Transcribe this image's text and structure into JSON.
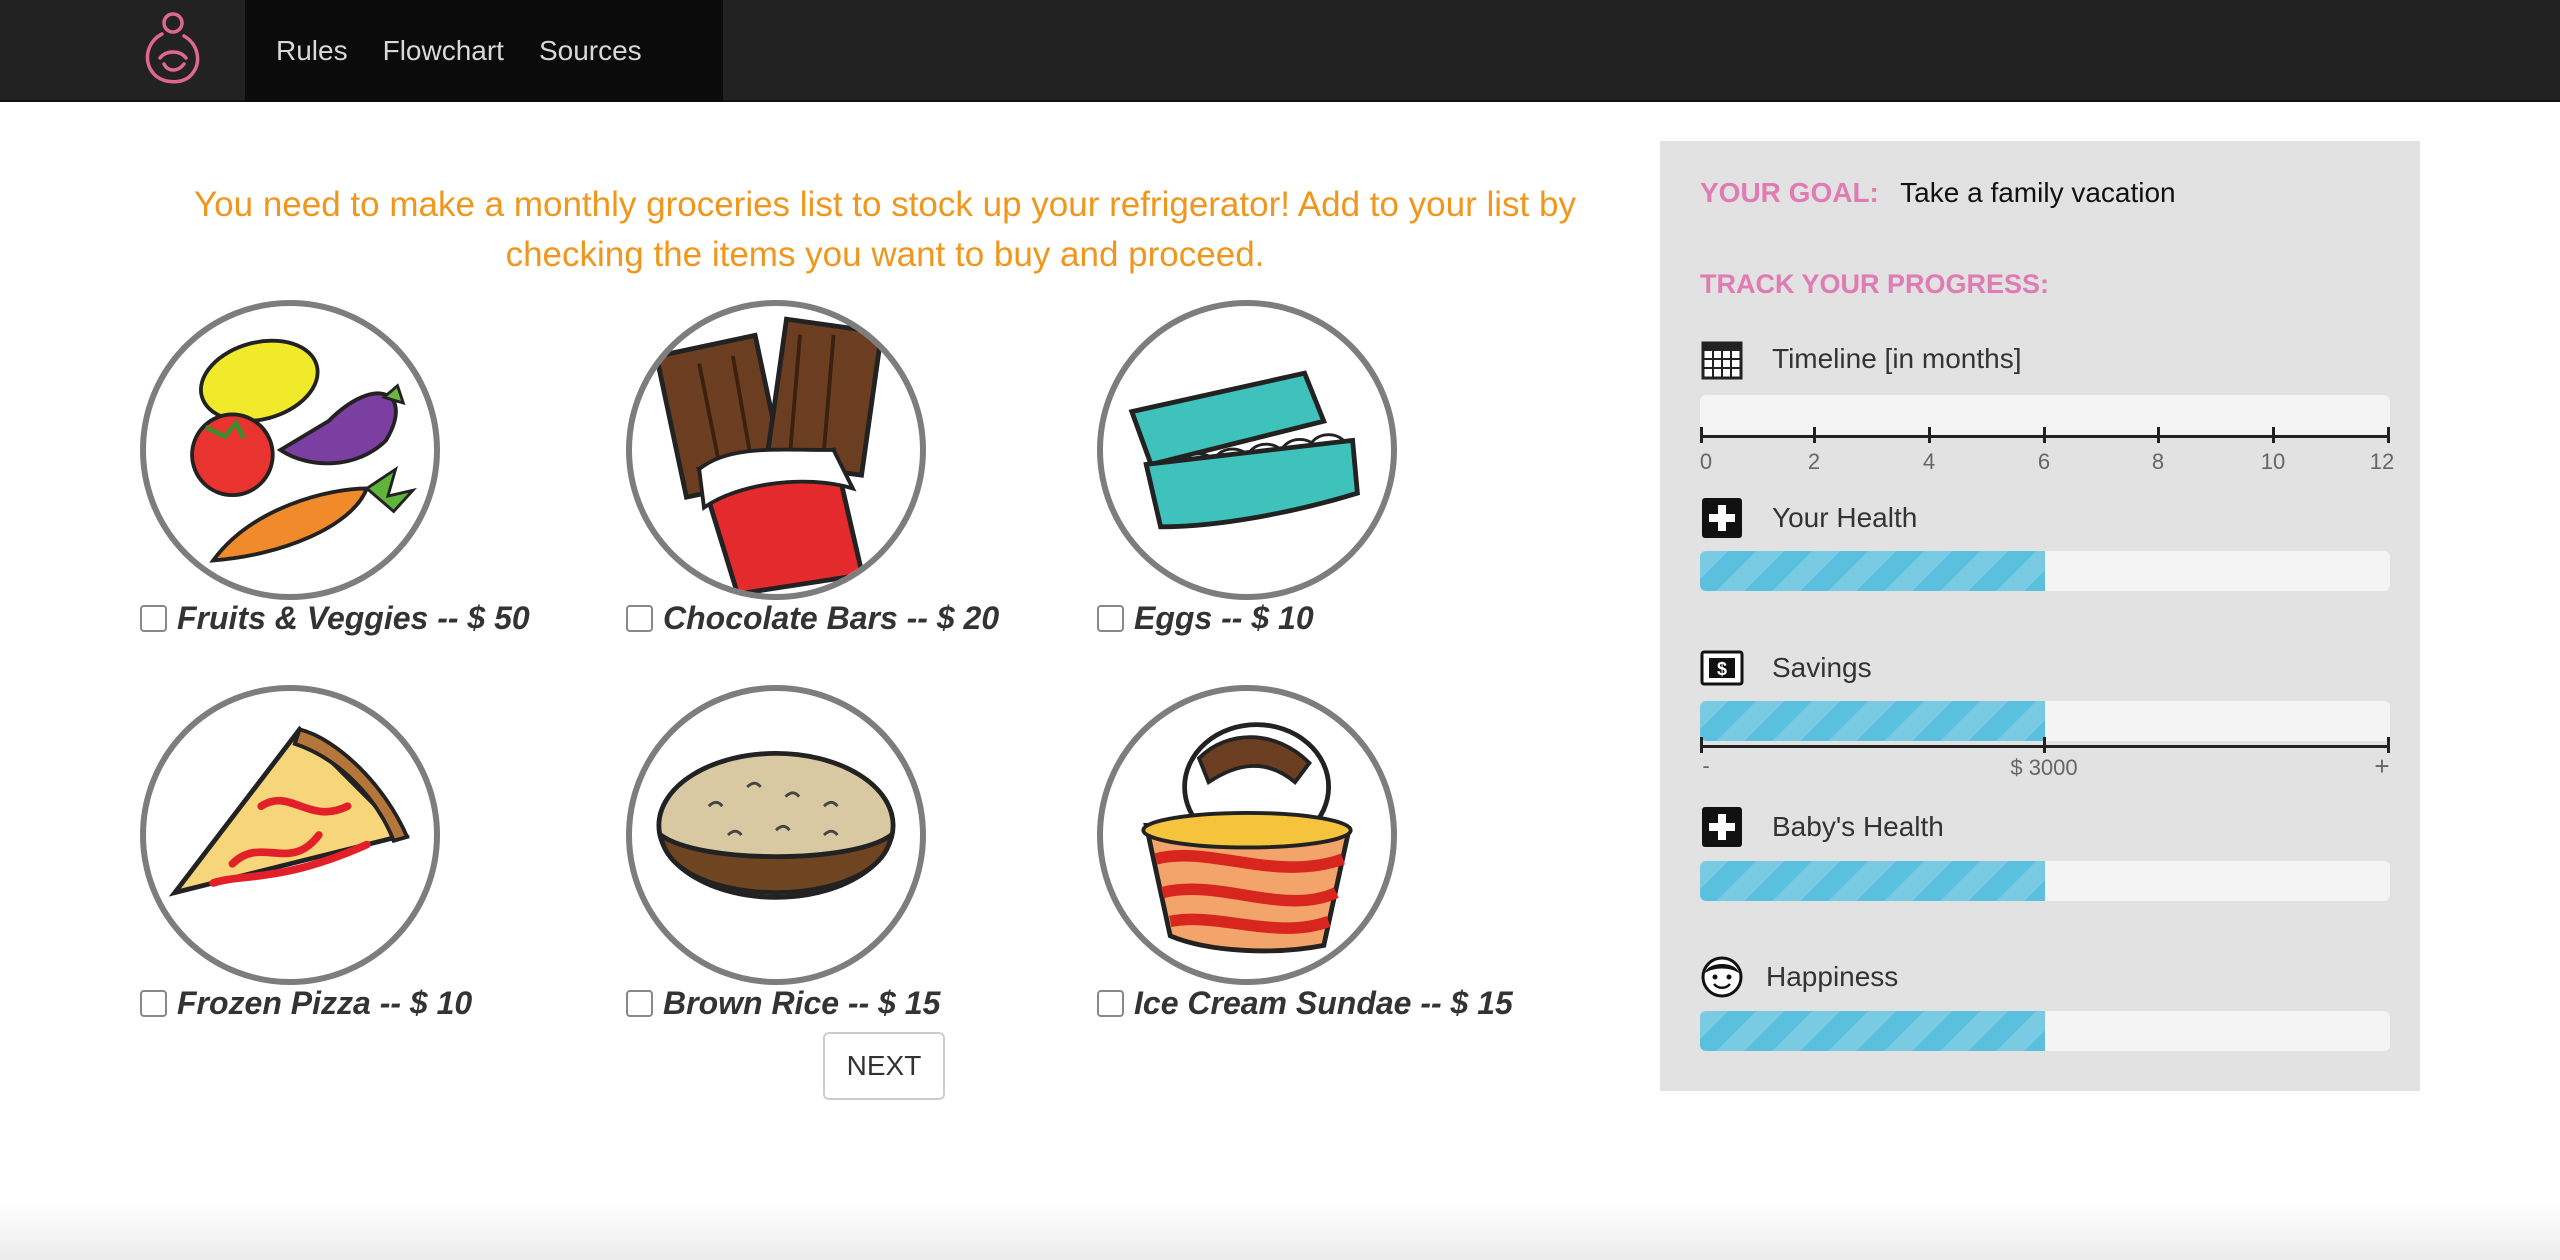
{
  "nav": {
    "brand_icon": "pregnant-woman-logo",
    "links": [
      "Rules",
      "Flowchart",
      "Sources"
    ]
  },
  "instructions": "You need to make a monthly groceries list to stock up your refrigerator! Add to your list by checking the items you want to buy and proceed.",
  "items": [
    {
      "label": "Fruits & Veggies -- $ 50",
      "icon": "fruits-veggies-icon",
      "checked": false
    },
    {
      "label": "Chocolate Bars -- $ 20",
      "icon": "chocolate-bars-icon",
      "checked": false
    },
    {
      "label": "Eggs -- $ 10",
      "icon": "eggs-icon",
      "checked": false
    },
    {
      "label": "Frozen Pizza -- $ 10",
      "icon": "pizza-icon",
      "checked": false
    },
    {
      "label": "Brown Rice -- $ 15",
      "icon": "rice-bowl-icon",
      "checked": false
    },
    {
      "label": "Ice Cream Sundae -- $ 15",
      "icon": "ice-cream-icon",
      "checked": false
    }
  ],
  "next_label": "NEXT",
  "sidebar": {
    "goal_key": "YOUR GOAL:",
    "goal_value": "Take a family vacation",
    "track_label": "TRACK YOUR PROGRESS:",
    "timeline": {
      "label": "Timeline [in months]",
      "icon": "calendar-icon",
      "value": 0,
      "ticks": [
        "0",
        "2",
        "4",
        "6",
        "8",
        "10",
        "12"
      ]
    },
    "health": {
      "label": "Your Health",
      "icon": "medical-cross-icon",
      "progress_percent": 50
    },
    "savings": {
      "label": "Savings",
      "icon": "dollar-icon",
      "progress_percent": 50,
      "scale_min": "-",
      "scale_mid": "$ 3000",
      "scale_max": "+"
    },
    "baby_health": {
      "label": "Baby's Health",
      "icon": "medical-cross-icon",
      "progress_percent": 50
    },
    "happiness": {
      "label": "Happiness",
      "icon": "smiley-face-icon",
      "progress_percent": 50
    }
  },
  "colors": {
    "navbar": "#222222",
    "accent_orange": "#f0961c",
    "accent_pink": "#e07bb3",
    "progress_blue": "#5bc0de",
    "sidebar_bg": "#e2e2e2"
  }
}
